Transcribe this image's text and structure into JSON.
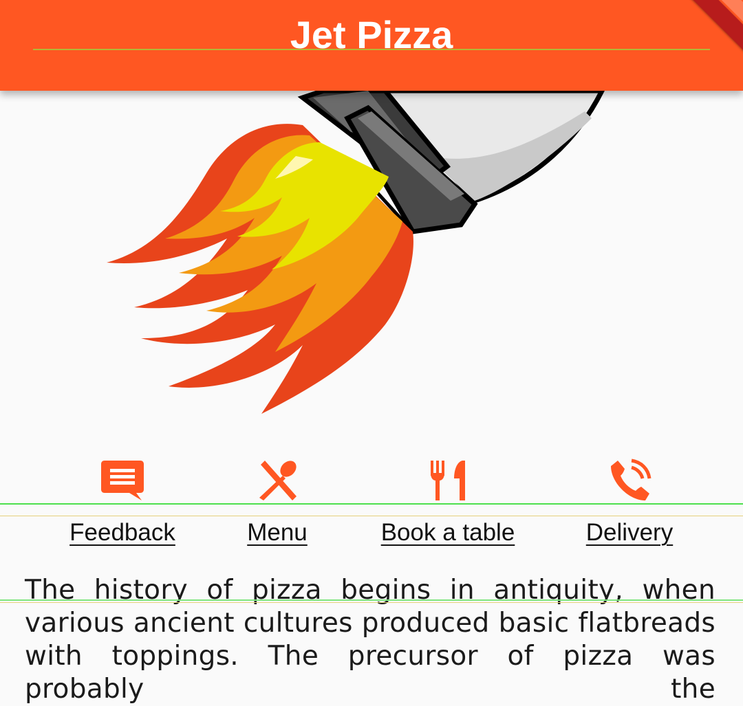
{
  "app": {
    "title": "Jet Pizza",
    "accent_color": "#ff5722"
  },
  "actions": [
    {
      "label": "Feedback",
      "icon": "feedback-icon"
    },
    {
      "label": "Menu",
      "icon": "restaurant-menu-icon"
    },
    {
      "label": "Book a table",
      "icon": "restaurant-icon"
    },
    {
      "label": "Delivery",
      "icon": "phone-in-talk-icon"
    }
  ],
  "content": {
    "history": "The history of pizza begins in antiquity, when various ancient cultures produced basic flatbreads with toppings. The precursor of pizza was probably the"
  }
}
